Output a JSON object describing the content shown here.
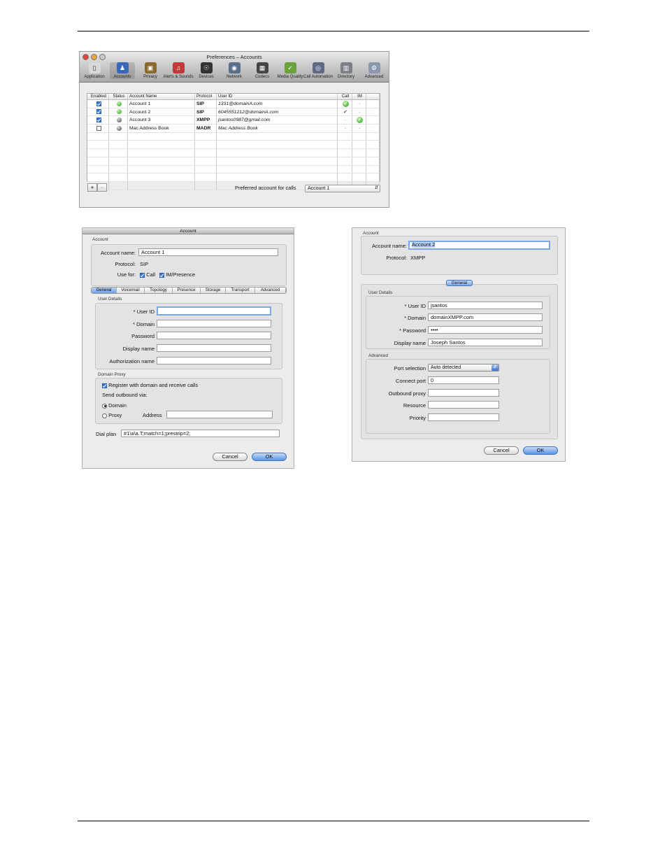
{
  "prefs": {
    "title": "Preferences – Accounts",
    "toolbar": [
      {
        "label": "Application",
        "icon": "application-icon",
        "color": "#d9d9d9",
        "glyph": "▯"
      },
      {
        "label": "Accounts",
        "icon": "accounts-icon",
        "color": "#3a68b8",
        "glyph": "♟"
      },
      {
        "label": "Privacy",
        "icon": "privacy-icon",
        "color": "#8a6a2c",
        "glyph": "▣"
      },
      {
        "label": "Alerts & Sounds",
        "icon": "alerts-sounds-icon",
        "color": "#c03a3a",
        "glyph": "♫"
      },
      {
        "label": "Devices",
        "icon": "devices-icon",
        "color": "#333333",
        "glyph": "☉"
      },
      {
        "label": "Network",
        "icon": "network-icon",
        "color": "#5a6f8a",
        "glyph": "◉"
      },
      {
        "label": "Codecs",
        "icon": "codecs-icon",
        "color": "#444444",
        "glyph": "▦"
      },
      {
        "label": "Media Quality",
        "icon": "media-quality-icon",
        "color": "#6aa33a",
        "glyph": "✓"
      },
      {
        "label": "Call Automation",
        "icon": "call-automation-icon",
        "color": "#5d6a86",
        "glyph": "◎"
      },
      {
        "label": "Directory",
        "icon": "directory-icon",
        "color": "#7a7f8a",
        "glyph": "▥"
      },
      {
        "label": "Advanced",
        "icon": "advanced-icon",
        "color": "#8a98ad",
        "glyph": "⚙"
      }
    ],
    "columns": [
      "Enabled",
      "Status",
      "Account Name",
      "Protocol",
      "User ID",
      "Call",
      "IM"
    ],
    "rows": [
      {
        "enabled": true,
        "status": "online",
        "name": "Account 1",
        "protocol": "SIP",
        "user_id": "1331@domainA.com",
        "call": "green-check",
        "im": "·"
      },
      {
        "enabled": true,
        "status": "online",
        "name": "Account 2",
        "protocol": "SIP",
        "user_id": "6045551212@domainA.com",
        "call": "check",
        "im": "·"
      },
      {
        "enabled": true,
        "status": "offline",
        "name": "Account 3",
        "protocol": "XMPP",
        "user_id": "jsantos0987@gmail.com",
        "call": "·",
        "im": "green-check"
      },
      {
        "enabled": false,
        "status": "offline",
        "name": "Mac Address Book",
        "protocol": "MADR",
        "user_id": "Mac Address Book",
        "call": "·",
        "im": "·"
      }
    ],
    "add_label": "+",
    "remove_label": "−",
    "preferred_label": "Preferred account for calls",
    "preferred_value": "Account 1"
  },
  "sip_dialog": {
    "title": "Account",
    "account_group": "Account",
    "account_name_label": "Account name:",
    "account_name_value": "Account 1",
    "protocol_label": "Protocol:",
    "protocol_value": "SIP",
    "use_for_label": "Use for:",
    "call_label": "Call",
    "im_label": "IM/Presence",
    "tabs": [
      "General",
      "Voicemail",
      "Topology",
      "Presence",
      "Storage",
      "Transport",
      "Advanced"
    ],
    "user_details_label": "User Details",
    "user_id_label": "* User ID",
    "domain_label": "* Domain",
    "password_label": "Password",
    "display_name_label": "Display name",
    "auth_name_label": "Authorization name",
    "domain_proxy_label": "Domain Proxy",
    "register_label": "Register with domain and receive calls",
    "send_outbound_label": "Send outbound via:",
    "domain_radio_label": "Domain",
    "proxy_radio_label": "Proxy",
    "address_label": "Address",
    "dial_plan_label": "Dial plan",
    "dial_plan_value": "#1\\a\\a.T;match=1;prestrip=2;",
    "cancel_label": "Cancel",
    "ok_label": "OK"
  },
  "xmpp_dialog": {
    "account_group": "Account",
    "account_name_label": "Account name:",
    "account_name_value": "Account 2",
    "protocol_label": "Protocol:",
    "protocol_value": "XMPP",
    "general_label": "General",
    "user_details_label": "User Details",
    "user_id_label": "* User ID",
    "user_id_value": "jsantos",
    "domain_label": "* Domain",
    "domain_value": "domainXMPP.com",
    "password_label": "* Password",
    "password_value": "••••",
    "display_name_label": "Display name",
    "display_name_value": "Joseph Santos",
    "advanced_label": "Advanced",
    "port_selection_label": "Port selection",
    "port_selection_value": "Auto detected",
    "connect_port_label": "Connect port",
    "connect_port_value": "0",
    "outbound_proxy_label": "Outbound proxy",
    "resource_label": "Resource",
    "priority_label": "Priority",
    "cancel_label": "Cancel",
    "ok_label": "OK"
  }
}
